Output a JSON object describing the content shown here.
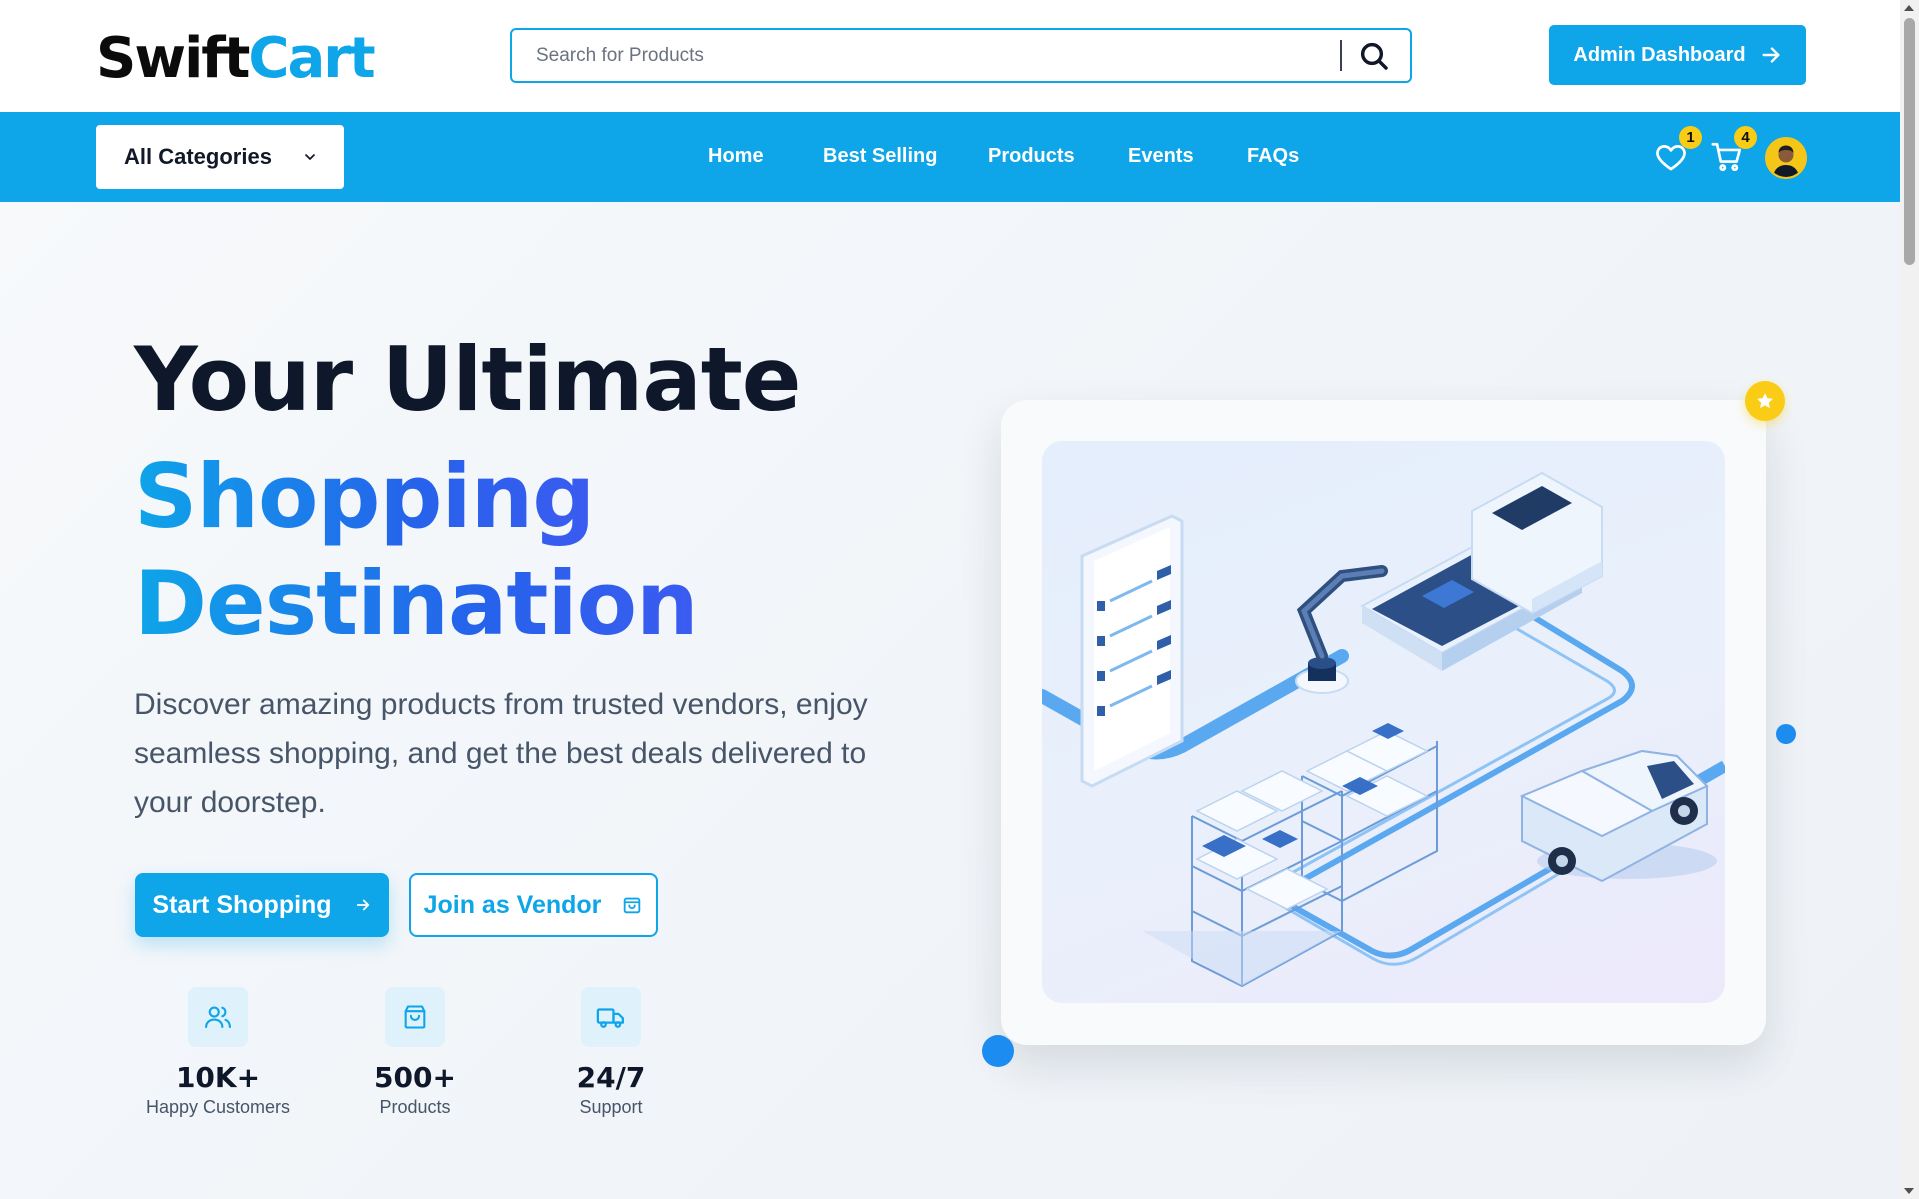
{
  "header": {
    "logo_part1": "Swift",
    "logo_part2": "Cart",
    "search_placeholder": "Search for Products",
    "admin_button_label": "Admin Dashboard"
  },
  "navbar": {
    "categories_label": "All Categories",
    "links": [
      "Home",
      "Best Selling",
      "Products",
      "Events",
      "FAQs"
    ],
    "wishlist_count": "1",
    "cart_count": "4"
  },
  "hero": {
    "title_line1": "Your Ultimate",
    "title_line2": "Shopping",
    "title_line3": "Destination",
    "lead": "Discover amazing products from trusted vendors, enjoy seamless shopping, and get the best deals delivered to your doorstep.",
    "primary_button": "Start Shopping",
    "secondary_button": "Join as Vendor",
    "stats": [
      {
        "value": "10K+",
        "label": "Happy Customers",
        "icon": "users-icon"
      },
      {
        "value": "500+",
        "label": "Products",
        "icon": "shopping-bag-icon"
      },
      {
        "value": "24/7",
        "label": "Support",
        "icon": "truck-icon"
      }
    ]
  },
  "colors": {
    "brand": "#0ea5e9",
    "brand_dark": "#2563eb",
    "badge": "#facc15",
    "text": "#0f172a"
  }
}
